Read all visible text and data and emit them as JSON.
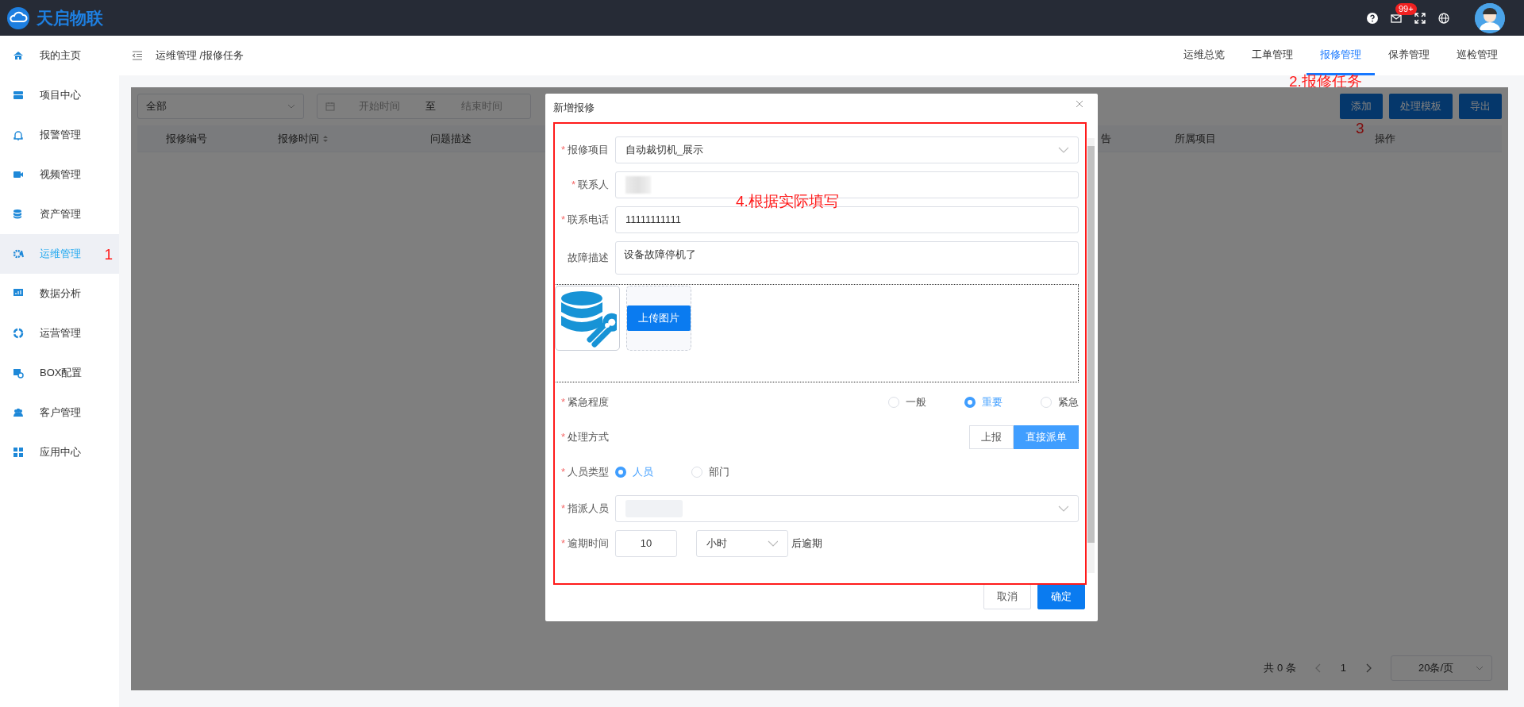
{
  "brand": {
    "name": "天启物联"
  },
  "header": {
    "mail_badge": "99+"
  },
  "sidebar": {
    "items": [
      {
        "label": "我的主页",
        "selected": false
      },
      {
        "label": "项目中心",
        "selected": false
      },
      {
        "label": "报警管理",
        "selected": false
      },
      {
        "label": "视频管理",
        "selected": false
      },
      {
        "label": "资产管理",
        "selected": false
      },
      {
        "label": "运维管理",
        "selected": true
      },
      {
        "label": "数据分析",
        "selected": false
      },
      {
        "label": "运营管理",
        "selected": false
      },
      {
        "label": "BOX配置",
        "selected": false
      },
      {
        "label": "客户管理",
        "selected": false
      },
      {
        "label": "应用中心",
        "selected": false
      }
    ]
  },
  "breadcrumb": "运维管理 /报修任务",
  "top_tabs": [
    {
      "label": "运维总览",
      "selected": false
    },
    {
      "label": "工单管理",
      "selected": false
    },
    {
      "label": "报修管理",
      "selected": true
    },
    {
      "label": "保养管理",
      "selected": false
    },
    {
      "label": "巡检管理",
      "selected": false
    }
  ],
  "filters": {
    "status": "全部",
    "start_placeholder": "开始时间",
    "separator": "至",
    "end_placeholder": "结束时间"
  },
  "actions": [
    "添加",
    "处理模板",
    "导出"
  ],
  "table": {
    "columns": [
      {
        "label": "报修编号"
      },
      {
        "label": "报修时间",
        "sortable": true
      },
      {
        "label": "问题描述"
      },
      {
        "label": "告"
      },
      {
        "label": "所属项目"
      },
      {
        "label": "操作"
      }
    ]
  },
  "pagination": {
    "total": "共 0 条",
    "page": "1",
    "page_size": "20条/页"
  },
  "modal": {
    "title": "新增报修",
    "fields": [
      {
        "kind": "select",
        "required_mark": "*",
        "label": "报修项目",
        "value": "自动裁切机_展示"
      },
      {
        "kind": "input",
        "required_mark": "*",
        "label": "联系人",
        "redacted": true
      },
      {
        "kind": "input",
        "required_mark": "*",
        "label": "联系电话",
        "value": "11111111111"
      },
      {
        "kind": "textarea",
        "label": "故障描述",
        "value": "设备故障停机了"
      },
      {
        "kind": "upload",
        "button": "上传图片"
      },
      {
        "kind": "radio_end",
        "required_mark": "*",
        "label": "紧急程度",
        "options": [
          {
            "label": "一般",
            "selected": false
          },
          {
            "label": "重要",
            "selected": true
          },
          {
            "label": "紧急",
            "selected": false
          }
        ]
      },
      {
        "kind": "segmented",
        "required_mark": "*",
        "label": "处理方式",
        "options": [
          {
            "label": "上报",
            "selected": false
          },
          {
            "label": "直接派单",
            "selected": true
          }
        ]
      },
      {
        "kind": "radio",
        "required_mark": "*",
        "label": "人员类型",
        "options": [
          {
            "label": "人员",
            "selected": true
          },
          {
            "label": "部门",
            "selected": false
          }
        ]
      },
      {
        "kind": "tags",
        "required_mark": "*",
        "label": "指派人员",
        "redacted": true
      },
      {
        "kind": "overdue",
        "required_mark": "*",
        "label": "逾期时间",
        "amount": "10",
        "unit": "小时",
        "suffix": "后逾期"
      }
    ],
    "buttons": [
      {
        "label": "取消",
        "kind": "default"
      },
      {
        "label": "确定",
        "kind": "primary"
      }
    ]
  },
  "annotations": [
    {
      "text": "1"
    },
    {
      "text": "2.报修任务"
    },
    {
      "text": "3"
    },
    {
      "text": "4.根据实际填写"
    }
  ]
}
